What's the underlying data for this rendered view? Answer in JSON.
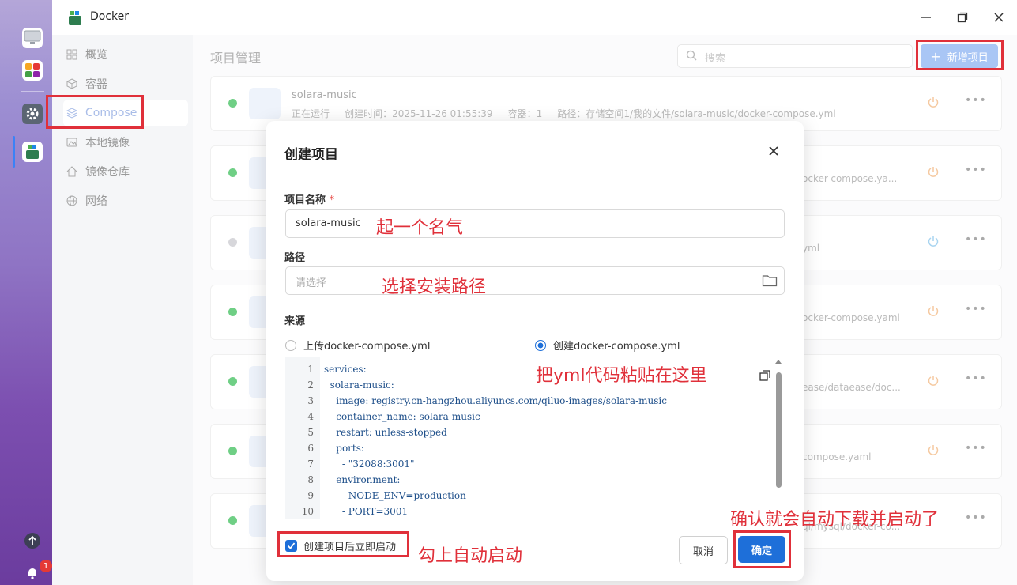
{
  "app": {
    "title": "Docker"
  },
  "sidebar": {
    "items": [
      {
        "label": "概览",
        "icon": "grid-icon"
      },
      {
        "label": "容器",
        "icon": "cube-icon"
      },
      {
        "label": "Compose",
        "icon": "layers-icon"
      },
      {
        "label": "本地镜像",
        "icon": "image-icon"
      },
      {
        "label": "镜像仓库",
        "icon": "home-icon"
      },
      {
        "label": "网络",
        "icon": "globe-icon"
      }
    ],
    "active": "Compose"
  },
  "main": {
    "title": "项目管理",
    "search_placeholder": "搜索",
    "new_button": "新增项目",
    "projects": [
      {
        "name": "solara-music",
        "status_text": "正在运行",
        "created_label": "创建时间：",
        "created": "2025-11-26 01:55:39",
        "containers_label": "容器：",
        "containers": "1",
        "path_label": "路径：",
        "path": "存储空间1/我的文件/solara-music/docker-compose.yml",
        "status_color": "#6fcf85"
      },
      {
        "path_tail": "ocker-compose.ya...",
        "status_color": "#6fcf85"
      },
      {
        "path_tail": "yml",
        "status_color": "#d7d7db"
      },
      {
        "path_tail": "ocker-compose.yaml",
        "status_color": "#6fcf85"
      },
      {
        "path_tail": "ease/dataease/doc...",
        "status_color": "#6fcf85"
      },
      {
        "path_tail": "compose.yaml",
        "status_color": "#6fcf85"
      },
      {
        "path_tail": "ql/mysql/docker-co...",
        "status_color": "#6fcf85"
      }
    ]
  },
  "modal": {
    "title": "创建项目",
    "name_label": "项目名称",
    "required_mark": "*",
    "name_value": "solara-music",
    "path_label": "路径",
    "path_placeholder": "请选择",
    "source_label": "来源",
    "source_options": [
      "上传docker-compose.yml",
      "创建docker-compose.yml"
    ],
    "source_selected": "创建docker-compose.yml",
    "code_lines": [
      "services:",
      "  solara-music:",
      "    image: registry.cn-hangzhou.aliyuncs.com/qiluo-images/solara-music",
      "    container_name: solara-music",
      "    restart: unless-stopped",
      "    ports:",
      "      - \"32088:3001\"",
      "    environment:",
      "      - NODE_ENV=production",
      "      - PORT=3001"
    ],
    "line_numbers": [
      "1",
      "2",
      "3",
      "4",
      "5",
      "6",
      "7",
      "8",
      "9",
      "10"
    ],
    "autostart_label": "创建项目后立即启动",
    "autostart_checked": true,
    "cancel_label": "取消",
    "ok_label": "确定"
  },
  "annotations": {
    "name_hint": "起一个名气",
    "path_hint": "选择安装路径",
    "yml_hint": "把yml代码粘贴在这里",
    "autostart_hint": "勾上自动启动",
    "confirm_hint": "确认就会自动下载并启动了"
  },
  "dock": {
    "notification_count": "1"
  },
  "colors": {
    "accent": "#1e6fd9",
    "annotation": "#e0303a"
  }
}
